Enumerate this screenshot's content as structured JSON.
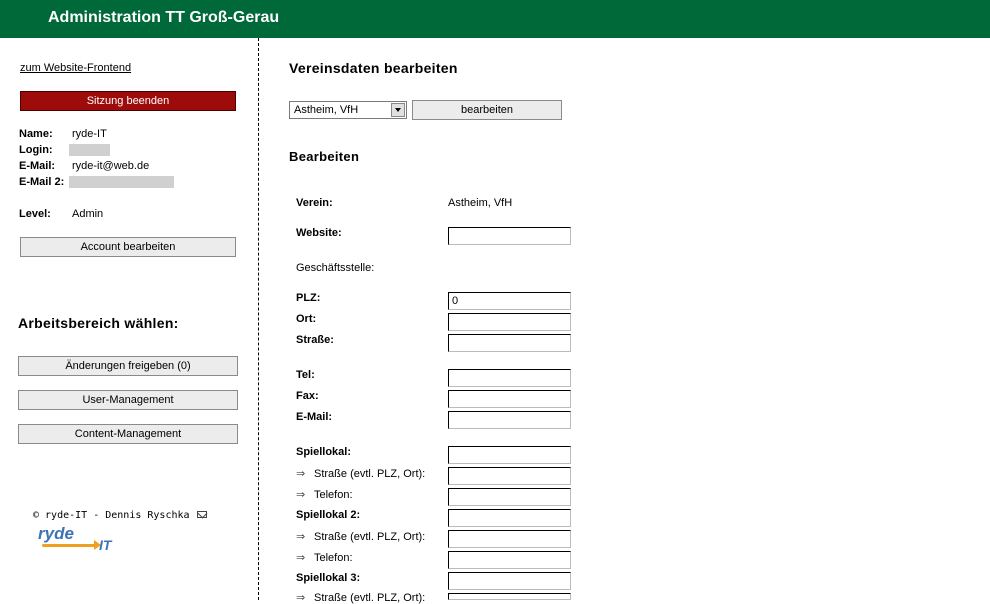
{
  "header": {
    "title": "Administration TT Groß-Gerau"
  },
  "sidebar": {
    "frontend_link": "zum Website-Frontend",
    "logout_button": "Sitzung beenden",
    "info": [
      {
        "label": "Name:",
        "value": "ryde-IT"
      },
      {
        "label": "Login:",
        "value": ""
      },
      {
        "label": "E-Mail:",
        "value": "ryde-it@web.de"
      },
      {
        "label": "E-Mail 2:",
        "value": ""
      },
      {
        "label": "Level:",
        "value": "Admin"
      }
    ],
    "account_button": "Account bearbeiten",
    "workspace_heading": "Arbeitsbereich wählen:",
    "workspace_buttons": [
      "Änderungen freigeben (0)",
      "User-Management",
      "Content-Management"
    ],
    "footer_text": "© ryde-IT - Dennis Ryschka",
    "logo": {
      "part1": "ryde",
      "part2": "IT"
    }
  },
  "main": {
    "heading": "Vereinsdaten bearbeiten",
    "club_select": {
      "value": "Astheim, VfH"
    },
    "edit_button": "bearbeiten",
    "subheading": "Bearbeiten",
    "verein": {
      "label": "Verein:",
      "value": "Astheim, VfH"
    },
    "fields": {
      "website": {
        "label": "Website:",
        "value": ""
      },
      "geschaeftsstelle": "Geschäftsstelle:",
      "plz": {
        "label": "PLZ:",
        "value": "0"
      },
      "ort": {
        "label": "Ort:",
        "value": ""
      },
      "strasse": {
        "label": "Straße:",
        "value": ""
      },
      "tel": {
        "label": "Tel:",
        "value": ""
      },
      "fax": {
        "label": "Fax:",
        "value": ""
      },
      "email": {
        "label": "E-Mail:",
        "value": ""
      },
      "spiellokal1": {
        "label": "Spiellokal:",
        "value": ""
      },
      "spiellokal1_strasse": {
        "label": "Straße (evtl. PLZ, Ort):",
        "value": ""
      },
      "spiellokal1_telefon": {
        "label": "Telefon:",
        "value": ""
      },
      "spiellokal2": {
        "label": "Spiellokal 2:",
        "value": ""
      },
      "spiellokal2_strasse": {
        "label": "Straße (evtl. PLZ, Ort):",
        "value": ""
      },
      "spiellokal2_telefon": {
        "label": "Telefon:",
        "value": ""
      },
      "spiellokal3": {
        "label": "Spiellokal 3:",
        "value": ""
      },
      "spiellokal3_strasse": {
        "label": "Straße (evtl. PLZ, Ort):",
        "value": ""
      }
    },
    "bullet": "⇒"
  }
}
